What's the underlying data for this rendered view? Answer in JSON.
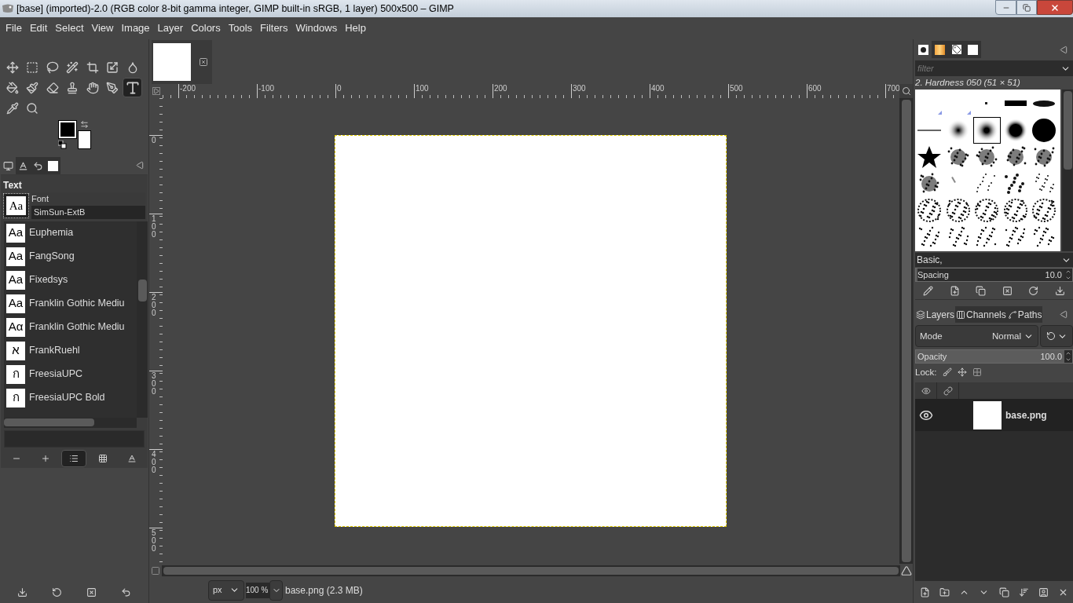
{
  "window": {
    "title": "[base] (imported)-2.0 (RGB color 8-bit gamma integer, GIMP built-in sRGB, 1 layer) 500x500 – GIMP"
  },
  "menu": [
    "File",
    "Edit",
    "Select",
    "View",
    "Image",
    "Layer",
    "Colors",
    "Tools",
    "Filters",
    "Windows",
    "Help"
  ],
  "tools": [
    {
      "selected": false
    },
    {
      "selected": false
    },
    {
      "selected": false
    },
    {
      "selected": false
    },
    {
      "selected": false
    },
    {
      "selected": false
    },
    {
      "selected": false
    },
    {
      "selected": false
    },
    {
      "selected": false
    },
    {
      "selected": false
    },
    {
      "selected": false
    },
    {
      "selected": false
    },
    {
      "selected": false
    },
    {
      "selected": true
    },
    {
      "selected": false
    },
    {
      "selected": false
    }
  ],
  "swatches": [
    {
      "color": "#000000"
    },
    {
      "color": "#ffffff"
    }
  ],
  "tool_options": {
    "tabs": [
      {
        "selected": true
      },
      {
        "selected": false
      },
      {
        "selected": false
      },
      {
        "selected": false
      }
    ],
    "title": "Text",
    "font_preview": "Aa",
    "font_label": "Font",
    "font_value": "SimSun-ExtB",
    "fonts": [
      {
        "preview": "Aa",
        "name": "Euphemia"
      },
      {
        "preview": "Aa",
        "name": "FangSong"
      },
      {
        "preview": "Aa",
        "name": "Fixedsys"
      },
      {
        "preview": "Aa",
        "name": "Franklin Gothic Mediu"
      },
      {
        "preview": "Aα",
        "name": "Franklin Gothic Mediu"
      },
      {
        "preview": "א",
        "name": "FrankRuehl"
      },
      {
        "preview": "ก",
        "name": "FreesiaUPC"
      },
      {
        "preview": "ก",
        "name": "FreesiaUPC Bold"
      }
    ],
    "view_buttons": [
      {
        "selected": false
      },
      {
        "selected": false
      },
      {
        "selected": true
      },
      {
        "selected": false
      },
      {
        "selected": false
      }
    ]
  },
  "rulers": {
    "horizontal": [
      "-200",
      "-100",
      "0",
      "100",
      "200",
      "300",
      "400",
      "500",
      "600",
      "700"
    ],
    "vertical": [
      "0",
      "100",
      "200",
      "300",
      "400",
      "500"
    ]
  },
  "status": {
    "unit": "px",
    "zoom": "100 %",
    "info": "base.png (2.3 MB)"
  },
  "brushes": {
    "tabs": [
      {
        "selected": true
      },
      {
        "selected": false
      },
      {
        "selected": false
      },
      {
        "selected": false
      }
    ],
    "filter_placeholder": "filter",
    "brush_name": "2. Hardness 050 (51 × 51)",
    "items": [
      {
        "selected": false
      },
      {
        "selected": false
      },
      {
        "selected": false
      },
      {
        "selected": false
      },
      {
        "selected": false
      },
      {
        "selected": false
      },
      {
        "selected": false
      },
      {
        "selected": true
      },
      {
        "selected": false
      },
      {
        "selected": false
      },
      {
        "selected": false
      },
      {
        "selected": false
      },
      {
        "selected": false
      },
      {
        "selected": false
      },
      {
        "selected": false
      },
      {
        "selected": false
      },
      {
        "selected": false
      },
      {
        "selected": false
      },
      {
        "selected": false
      },
      {
        "selected": false
      },
      {
        "selected": false
      },
      {
        "selected": false
      },
      {
        "selected": false
      },
      {
        "selected": false
      },
      {
        "selected": false
      },
      {
        "selected": false
      },
      {
        "selected": false
      },
      {
        "selected": false
      },
      {
        "selected": false
      },
      {
        "selected": false
      }
    ],
    "tag": "Basic,",
    "spacing": {
      "label": "Spacing",
      "value": "10.0",
      "level": 0.01
    }
  },
  "layers": {
    "tabs": [
      {
        "label": "Layers",
        "selected": true
      },
      {
        "label": "Channels",
        "selected": false
      },
      {
        "label": "Paths",
        "selected": false
      }
    ],
    "mode_label": "Mode",
    "mode": "Normal",
    "opacity": {
      "label": "Opacity",
      "value": "100.0",
      "level": 1
    },
    "lock_label": "Lock:",
    "items": [
      {
        "name": "base.png",
        "visible": true
      }
    ]
  }
}
